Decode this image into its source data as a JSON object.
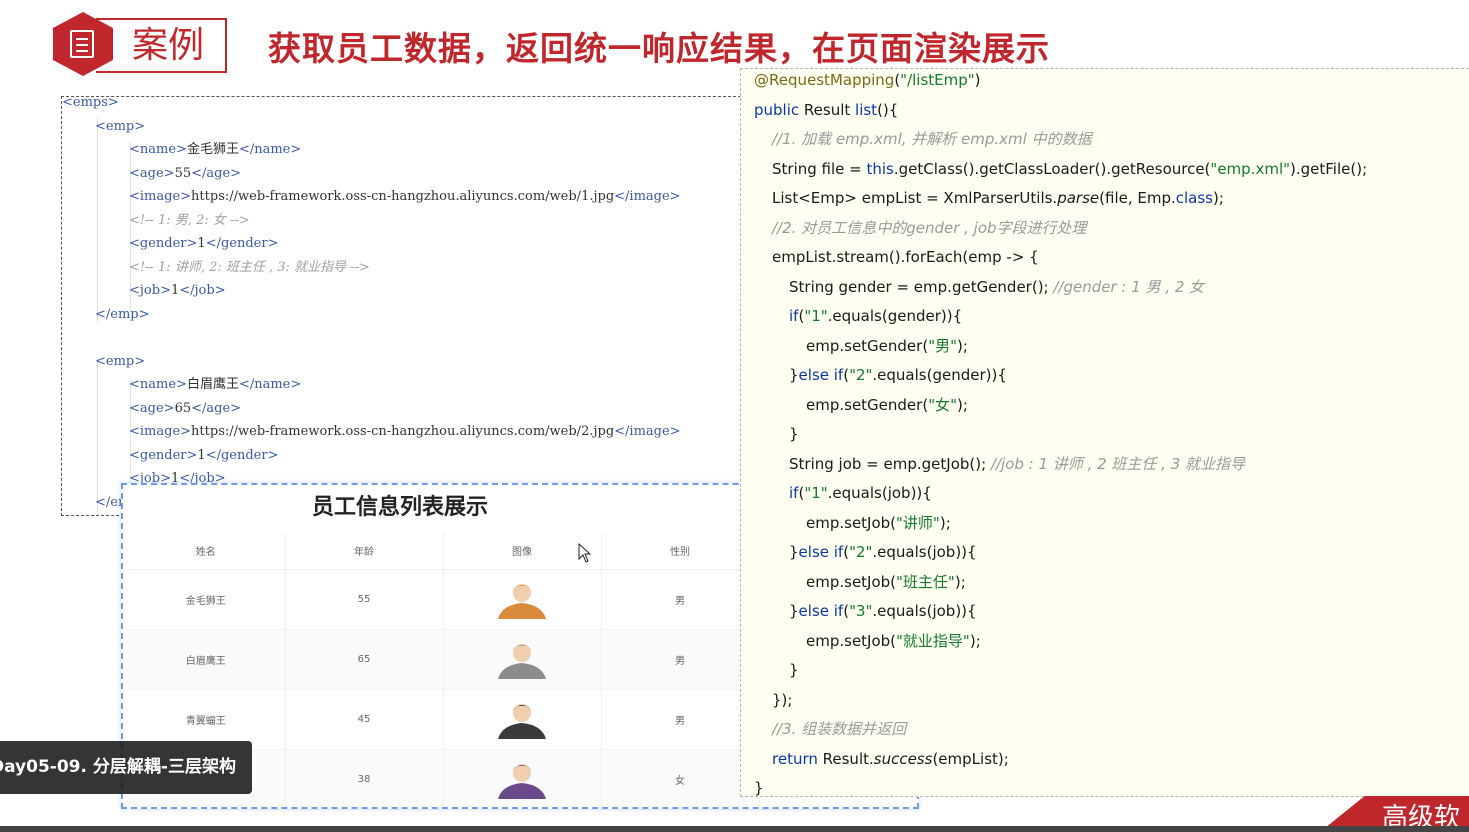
{
  "header": {
    "tag": "案例",
    "title": "获取员工数据，返回统一响应结果，在页面渲染展示"
  },
  "xml": {
    "lines": [
      {
        "indent": 0,
        "parts": [
          [
            "t",
            "<emps>"
          ]
        ]
      },
      {
        "indent": 1,
        "parts": [
          [
            "t",
            "<emp>"
          ]
        ]
      },
      {
        "indent": 2,
        "parts": [
          [
            "t",
            "<name>"
          ],
          [
            "x",
            "金毛狮王"
          ],
          [
            "t",
            "</name>"
          ]
        ]
      },
      {
        "indent": 2,
        "parts": [
          [
            "t",
            "<age>"
          ],
          [
            "x",
            "55"
          ],
          [
            "t",
            "</age>"
          ]
        ]
      },
      {
        "indent": 2,
        "parts": [
          [
            "t",
            "<image>"
          ],
          [
            "x",
            "https://web-framework.oss-cn-hangzhou.aliyuncs.com/web/1.jpg"
          ],
          [
            "t",
            "</image>"
          ]
        ]
      },
      {
        "indent": 2,
        "parts": [
          [
            "c",
            "<!-- 1: 男, 2: 女 -->"
          ]
        ]
      },
      {
        "indent": 2,
        "parts": [
          [
            "t",
            "<gender>"
          ],
          [
            "x",
            "1"
          ],
          [
            "t",
            "</gender>"
          ]
        ]
      },
      {
        "indent": 2,
        "parts": [
          [
            "c",
            "<!-- 1: 讲师, 2: 班主任 , 3: 就业指导 -->"
          ]
        ]
      },
      {
        "indent": 2,
        "parts": [
          [
            "t",
            "<job>"
          ],
          [
            "x",
            "1"
          ],
          [
            "t",
            "</job>"
          ]
        ]
      },
      {
        "indent": 1,
        "parts": [
          [
            "t",
            "</emp>"
          ]
        ]
      },
      {
        "indent": 1,
        "parts": []
      },
      {
        "indent": 1,
        "parts": [
          [
            "t",
            "<emp>"
          ]
        ]
      },
      {
        "indent": 2,
        "parts": [
          [
            "t",
            "<name>"
          ],
          [
            "x",
            "白眉鹰王"
          ],
          [
            "t",
            "</name>"
          ]
        ]
      },
      {
        "indent": 2,
        "parts": [
          [
            "t",
            "<age>"
          ],
          [
            "x",
            "65"
          ],
          [
            "t",
            "</age>"
          ]
        ]
      },
      {
        "indent": 2,
        "parts": [
          [
            "t",
            "<image>"
          ],
          [
            "x",
            "https://web-framework.oss-cn-hangzhou.aliyuncs.com/web/2.jpg"
          ],
          [
            "t",
            "</image>"
          ]
        ]
      },
      {
        "indent": 2,
        "parts": [
          [
            "t",
            "<gender>"
          ],
          [
            "x",
            "1"
          ],
          [
            "t",
            "</gender>"
          ]
        ]
      },
      {
        "indent": 2,
        "parts": [
          [
            "t",
            "<job>"
          ],
          [
            "x",
            "1"
          ],
          [
            "t",
            "</job>"
          ]
        ]
      },
      {
        "indent": 1,
        "parts": [
          [
            "t",
            "</emp>"
          ]
        ]
      }
    ]
  },
  "table": {
    "title": "员工信息列表展示",
    "columns": [
      "姓名",
      "年龄",
      "图像",
      "性别"
    ],
    "rows": [
      {
        "name": "金毛狮王",
        "age": "55",
        "gender": "男",
        "avatar_color": "#d98a3a"
      },
      {
        "name": "白眉鹰王",
        "age": "65",
        "gender": "男",
        "avatar_color": "#8c8c8c"
      },
      {
        "name": "青翼蝠王",
        "age": "45",
        "gender": "男",
        "avatar_color": "#3a3a3a"
      },
      {
        "name": "",
        "age": "38",
        "gender": "女",
        "avatar_color": "#6a4a8a"
      }
    ]
  },
  "code": {
    "lines": [
      {
        "indent": 0,
        "parts": [
          [
            "a",
            "@RequestMapping"
          ],
          [
            "n",
            "("
          ],
          [
            "s",
            "\"/listEmp\""
          ],
          [
            "n",
            ")"
          ]
        ]
      },
      {
        "indent": 0,
        "parts": [
          [
            "k",
            "public "
          ],
          [
            "n",
            "Result "
          ],
          [
            "k",
            "list"
          ],
          [
            "n",
            "(){"
          ]
        ]
      },
      {
        "indent": 1,
        "parts": [
          [
            "c",
            "//1. 加载 emp.xml, 并解析 emp.xml 中的数据"
          ]
        ]
      },
      {
        "indent": 1,
        "parts": [
          [
            "n",
            "String file = "
          ],
          [
            "k",
            "this"
          ],
          [
            "n",
            ".getClass().getClassLoader().getResource("
          ],
          [
            "s",
            "\"emp.xml\""
          ],
          [
            "n",
            ").getFile();"
          ]
        ]
      },
      {
        "indent": 1,
        "parts": [
          [
            "n",
            "List<Emp> empList = XmlParserUtils."
          ],
          [
            "i",
            "parse"
          ],
          [
            "n",
            "(file, Emp."
          ],
          [
            "k",
            "class"
          ],
          [
            "n",
            ");"
          ]
        ]
      },
      {
        "indent": 1,
        "parts": [
          [
            "c",
            "//2. 对员工信息中的gender , job字段进行处理"
          ]
        ]
      },
      {
        "indent": 1,
        "parts": [
          [
            "n",
            "empList.stream().forEach(emp -> {"
          ]
        ]
      },
      {
        "indent": 2,
        "parts": [
          [
            "n",
            "String gender = emp.getGender(); "
          ],
          [
            "c",
            "//gender : 1 男 , 2 女"
          ]
        ]
      },
      {
        "indent": 2,
        "parts": [
          [
            "k",
            "if"
          ],
          [
            "n",
            "("
          ],
          [
            "s",
            "\"1\""
          ],
          [
            "n",
            ".equals(gender)){"
          ]
        ]
      },
      {
        "indent": 3,
        "parts": [
          [
            "n",
            "emp.setGender("
          ],
          [
            "s",
            "\"男\""
          ],
          [
            "n",
            ");"
          ]
        ]
      },
      {
        "indent": 2,
        "parts": [
          [
            "n",
            "}"
          ],
          [
            "k",
            "else if"
          ],
          [
            "n",
            "("
          ],
          [
            "s",
            "\"2\""
          ],
          [
            "n",
            ".equals(gender)){"
          ]
        ]
      },
      {
        "indent": 3,
        "parts": [
          [
            "n",
            "emp.setGender("
          ],
          [
            "s",
            "\"女\""
          ],
          [
            "n",
            ");"
          ]
        ]
      },
      {
        "indent": 2,
        "parts": [
          [
            "n",
            "}"
          ]
        ]
      },
      {
        "indent": 2,
        "parts": [
          [
            "n",
            "String job = emp.getJob(); "
          ],
          [
            "c",
            "//job : 1 讲师 , 2 班主任 , 3 就业指导"
          ]
        ]
      },
      {
        "indent": 2,
        "parts": [
          [
            "k",
            "if"
          ],
          [
            "n",
            "("
          ],
          [
            "s",
            "\"1\""
          ],
          [
            "n",
            ".equals(job)){"
          ]
        ]
      },
      {
        "indent": 3,
        "parts": [
          [
            "n",
            "emp.setJob("
          ],
          [
            "s",
            "\"讲师\""
          ],
          [
            "n",
            ");"
          ]
        ]
      },
      {
        "indent": 2,
        "parts": [
          [
            "n",
            "}"
          ],
          [
            "k",
            "else if"
          ],
          [
            "n",
            "("
          ],
          [
            "s",
            "\"2\""
          ],
          [
            "n",
            ".equals(job)){"
          ]
        ]
      },
      {
        "indent": 3,
        "parts": [
          [
            "n",
            "emp.setJob("
          ],
          [
            "s",
            "\"班主任\""
          ],
          [
            "n",
            ");"
          ]
        ]
      },
      {
        "indent": 2,
        "parts": [
          [
            "n",
            "}"
          ],
          [
            "k",
            "else if"
          ],
          [
            "n",
            "("
          ],
          [
            "s",
            "\"3\""
          ],
          [
            "n",
            ".equals(job)){"
          ]
        ]
      },
      {
        "indent": 3,
        "parts": [
          [
            "n",
            "emp.setJob("
          ],
          [
            "s",
            "\"就业指导\""
          ],
          [
            "n",
            ");"
          ]
        ]
      },
      {
        "indent": 2,
        "parts": [
          [
            "n",
            "}"
          ]
        ]
      },
      {
        "indent": 1,
        "parts": [
          [
            "n",
            "});"
          ]
        ]
      },
      {
        "indent": 1,
        "parts": [
          [
            "c",
            "//3. 组装数据并返回"
          ]
        ]
      },
      {
        "indent": 1,
        "parts": [
          [
            "k",
            "return "
          ],
          [
            "n",
            "Result."
          ],
          [
            "i",
            "success"
          ],
          [
            "n",
            "(empList);"
          ]
        ]
      },
      {
        "indent": 0,
        "parts": [
          [
            "n",
            "}"
          ]
        ]
      }
    ]
  },
  "overlay": {
    "episode": "Day05-09. 分层解耦-三层架构",
    "brand": "高级软"
  },
  "colors": {
    "brand_red": "#c0272d",
    "xml_tag": "#3a58a8",
    "code_keyword": "#0a37a8",
    "code_string": "#137a2c",
    "code_bg": "#fffff2"
  }
}
